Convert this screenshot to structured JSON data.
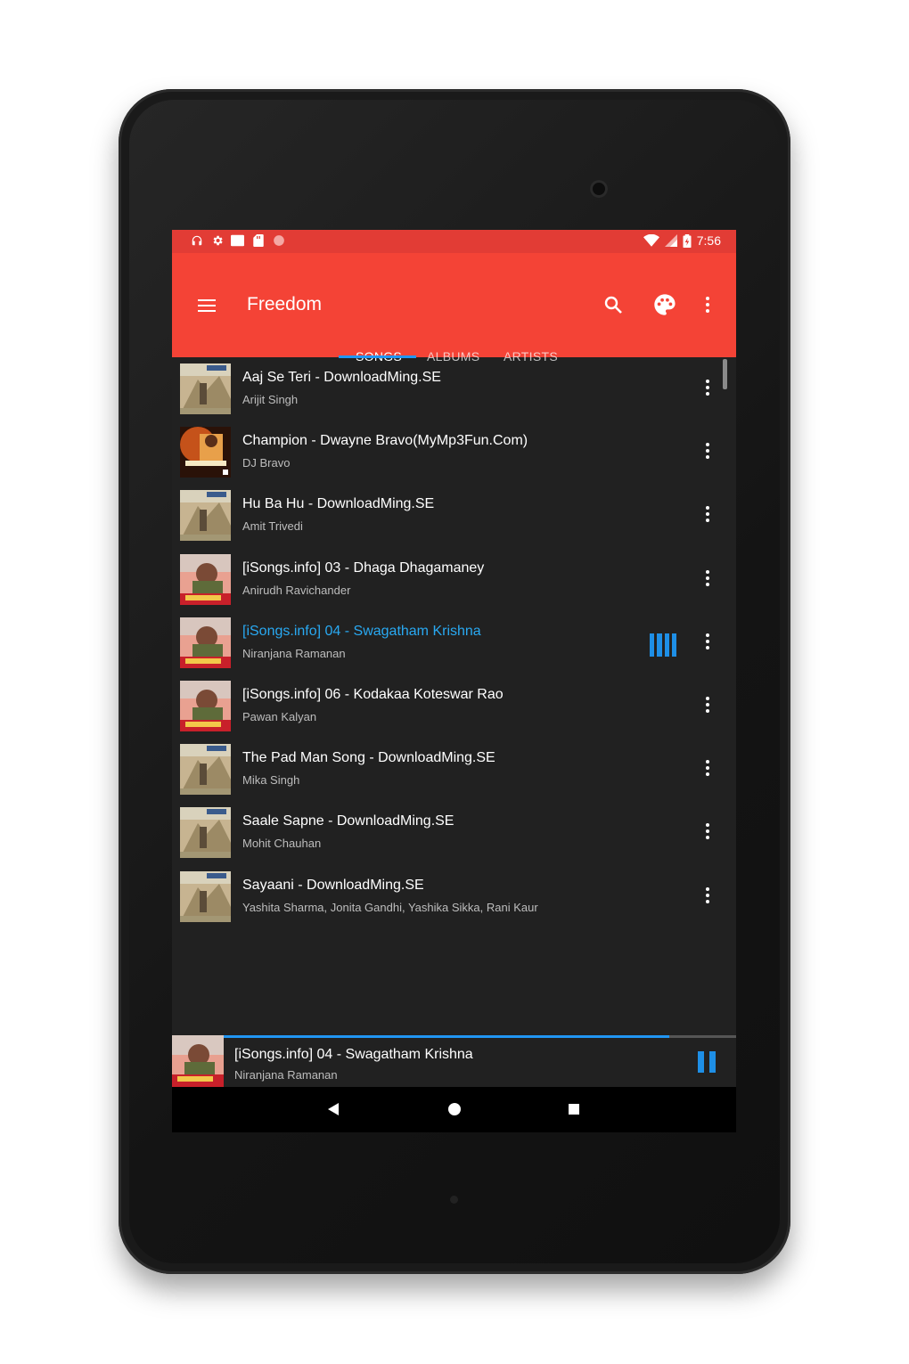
{
  "statusbar": {
    "time": "7:56",
    "left_icons": [
      "headphones-icon",
      "gear-icon",
      "photo-icon",
      "sd-card-icon",
      "record-icon"
    ],
    "right_icons": [
      "wifi-icon",
      "signal-icon",
      "battery-icon"
    ]
  },
  "appbar": {
    "title": "Freedom",
    "menu_icon": "menu-icon",
    "search_icon": "search-icon",
    "palette_icon": "palette-icon",
    "overflow_icon": "more-vert-icon",
    "color": "#f44336",
    "status_color": "#e23c35"
  },
  "tabs": [
    {
      "label": "SONGS",
      "selected": true
    },
    {
      "label": "ALBUMS",
      "selected": false
    },
    {
      "label": "ARTISTS",
      "selected": false
    }
  ],
  "songs": [
    {
      "title": "Aaj Se Teri -  DownloadMing.SE",
      "artist": "Arijit Singh",
      "art": "padman",
      "playing": false
    },
    {
      "title": "Champion - Dwayne Bravo(MyMp3Fun.Com)",
      "artist": "DJ Bravo",
      "art": "bravo",
      "playing": false
    },
    {
      "title": "Hu Ba Hu -  DownloadMing.SE",
      "artist": "Amit Trivedi",
      "art": "padman",
      "playing": false
    },
    {
      "title": "[iSongs.info] 03 - Dhaga Dhagamaney",
      "artist": "Anirudh Ravichander",
      "art": "pawan",
      "playing": false
    },
    {
      "title": "[iSongs.info] 04 - Swagatham Krishna",
      "artist": "Niranjana Ramanan",
      "art": "pawan",
      "playing": true
    },
    {
      "title": "[iSongs.info] 06 - Kodakaa Koteswar Rao",
      "artist": "Pawan Kalyan",
      "art": "pawan",
      "playing": false
    },
    {
      "title": "The Pad Man Song -  DownloadMing.SE",
      "artist": "Mika Singh",
      "art": "padman",
      "playing": false
    },
    {
      "title": "Saale Sapne -  DownloadMing.SE",
      "artist": "Mohit Chauhan",
      "art": "padman",
      "playing": false
    },
    {
      "title": "Sayaani -  DownloadMing.SE",
      "artist": "Yashita Sharma, Jonita Gandhi, Yashika Sikka, Rani Kaur",
      "art": "padman",
      "playing": false
    }
  ],
  "now_playing": {
    "title": "[iSongs.info] 04 - Swagatham Krishna",
    "artist": "Niranjana Ramanan",
    "progress": 0.87,
    "accent": "#2196f3"
  },
  "navbar": [
    "back-icon",
    "home-icon",
    "recents-icon"
  ]
}
